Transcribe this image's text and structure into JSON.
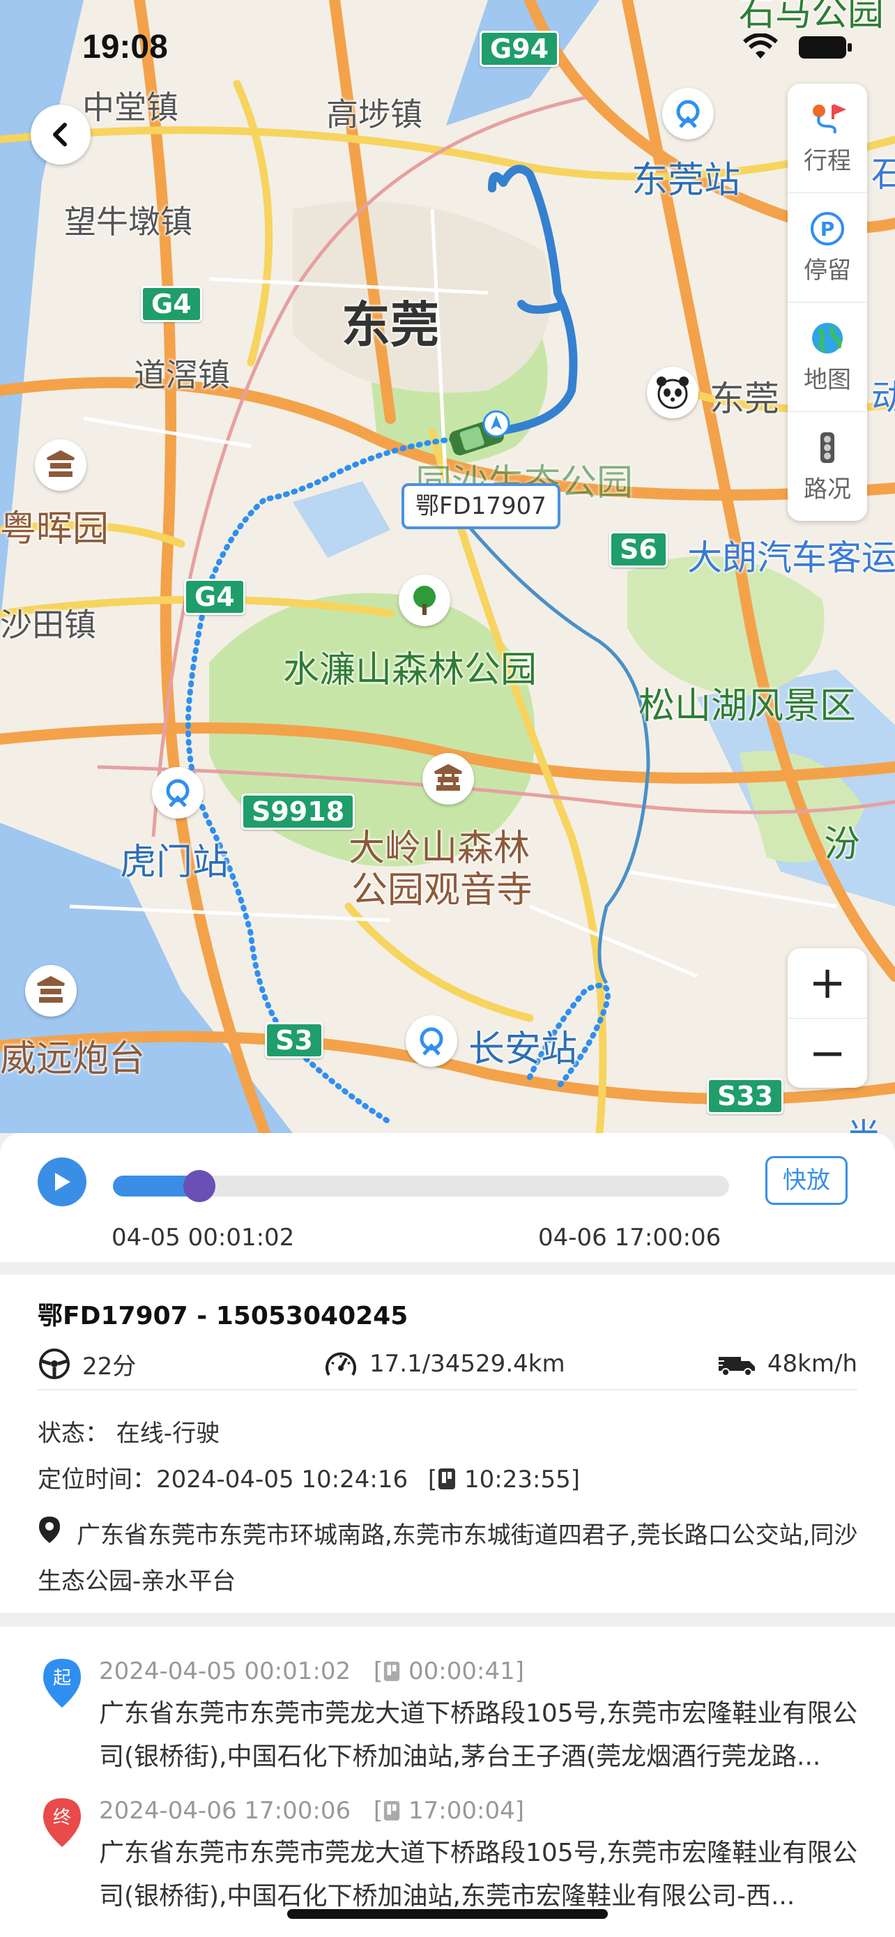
{
  "status_bar": {
    "time": "19:08"
  },
  "map": {
    "towns": [
      "中堂镇",
      "高埗镇",
      "望牛墩镇",
      "道滘镇",
      "粤晖园",
      "沙田镇",
      "东莞",
      "威远炮台"
    ],
    "parks": [
      "水濂山森林公园",
      "松山湖风景区",
      "同沙生态公园"
    ],
    "temple": [
      "大岭山森林",
      "公园观音寺"
    ],
    "stations": [
      "东莞站",
      "虎门站",
      "长安站"
    ],
    "other_labels": [
      "大朗汽车客运",
      "东莞",
      "石马公园",
      "石",
      "动",
      "汾",
      "半"
    ],
    "highways": [
      "G94",
      "G4",
      "G4",
      "S6",
      "S9918",
      "S3",
      "S33"
    ],
    "vehicle_tag": "鄂FD17907",
    "tools": [
      {
        "icon": "trip-route-icon",
        "label": "行程"
      },
      {
        "icon": "parking-icon",
        "label": "停留"
      },
      {
        "icon": "globe-icon",
        "label": "地图"
      },
      {
        "icon": "traffic-light-icon",
        "label": "路况"
      }
    ],
    "zoom": {
      "in": "+",
      "out": "−"
    }
  },
  "playback": {
    "start_time": "04-05 00:01:02",
    "end_time": "04-06 17:00:06",
    "progress": 0.14,
    "speed_button": "快放"
  },
  "vehicle": {
    "title": "鄂FD17907 - 15053040245",
    "duration": "22分",
    "mileage": "17.1/34529.4km",
    "speed": "48km/h",
    "status": "状态：  在线-行驶",
    "locate_time_label": "定位时间：",
    "locate_time": "2024-04-05 10:24:16",
    "gps_time": "10:23:55",
    "address": "广东省东莞市东莞市环城南路,东莞市东城街道四君子,莞长路口公交站,同沙生态公园-亲水平台"
  },
  "trip_points": [
    {
      "marker": "起",
      "color": "#2f8ff0",
      "time": "2024-04-05 00:01:02",
      "gps_time": "00:00:41",
      "address": "广东省东莞市东莞市莞龙大道下桥路段105号,东莞市宏隆鞋业有限公司(银桥街),中国石化下桥加油站,茅台王子酒(莞龙烟酒行莞龙路..."
    },
    {
      "marker": "终",
      "color": "#e94a4a",
      "time": "2024-04-06 17:00:06",
      "gps_time": "17:00:04",
      "address": "广东省东莞市东莞市莞龙大道下桥路段105号,东莞市宏隆鞋业有限公司(银桥街),中国石化下桥加油站,东莞市宏隆鞋业有限公司-西..."
    }
  ]
}
